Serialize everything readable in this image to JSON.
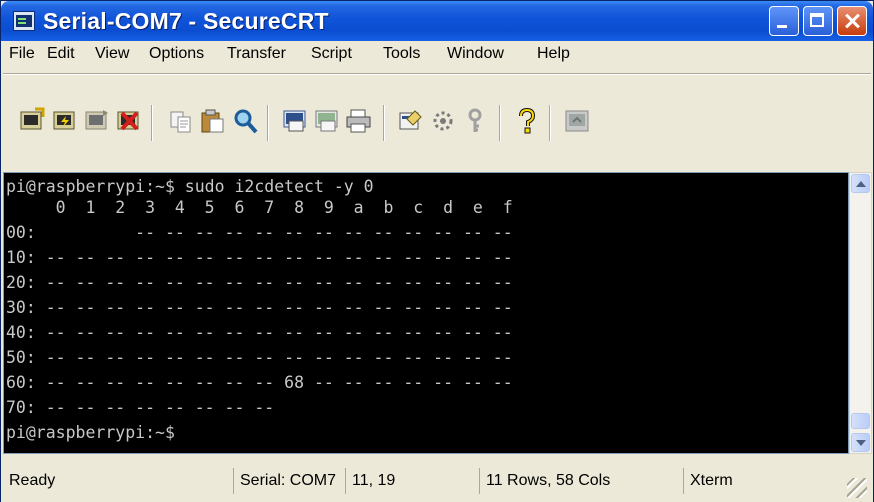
{
  "window": {
    "title": "Serial-COM7 - SecureCRT",
    "icon": "securecrt-app-icon",
    "buttons": [
      "minimize-icon",
      "maximize-icon",
      "close-icon"
    ]
  },
  "menu": [
    {
      "label": "File"
    },
    {
      "label": "Edit"
    },
    {
      "label": "View"
    },
    {
      "label": "Options"
    },
    {
      "label": "Transfer"
    },
    {
      "label": "Script"
    },
    {
      "label": "Tools"
    },
    {
      "label": "Window"
    },
    {
      "label": "Help"
    }
  ],
  "toolbar": [
    {
      "icon": "connect-icon"
    },
    {
      "icon": "quick-connect-icon"
    },
    {
      "icon": "reconnect-icon"
    },
    {
      "icon": "disconnect-icon"
    },
    {
      "icon": "copy-icon"
    },
    {
      "icon": "paste-icon"
    },
    {
      "icon": "find-icon"
    },
    {
      "icon": "session-options-icon"
    },
    {
      "icon": "print-screen-icon"
    },
    {
      "icon": "print-icon"
    },
    {
      "icon": "global-options-icon"
    },
    {
      "icon": "keymap-icon"
    },
    {
      "icon": "key-icon"
    },
    {
      "icon": "help-icon"
    },
    {
      "icon": "sftp-icon"
    }
  ],
  "terminal": {
    "lines": [
      "pi@raspberrypi:~$ sudo i2cdetect -y 0",
      "     0  1  2  3  4  5  6  7  8  9  a  b  c  d  e  f",
      "00:          -- -- -- -- -- -- -- -- -- -- -- -- --",
      "10: -- -- -- -- -- -- -- -- -- -- -- -- -- -- -- --",
      "20: -- -- -- -- -- -- -- -- -- -- -- -- -- -- -- --",
      "30: -- -- -- -- -- -- -- -- -- -- -- -- -- -- -- --",
      "40: -- -- -- -- -- -- -- -- -- -- -- -- -- -- -- --",
      "50: -- -- -- -- -- -- -- -- -- -- -- -- -- -- -- --",
      "60: -- -- -- -- -- -- -- -- 68 -- -- -- -- -- -- --",
      "70: -- -- -- -- -- -- -- --",
      "pi@raspberrypi:~$"
    ],
    "background": "#000000",
    "foreground": "#c8c8c8"
  },
  "status": {
    "ready": "Ready",
    "connection": "Serial: COM7",
    "cursor": "11, 19",
    "size": "11 Rows, 58 Cols",
    "emulation": "Xterm"
  }
}
